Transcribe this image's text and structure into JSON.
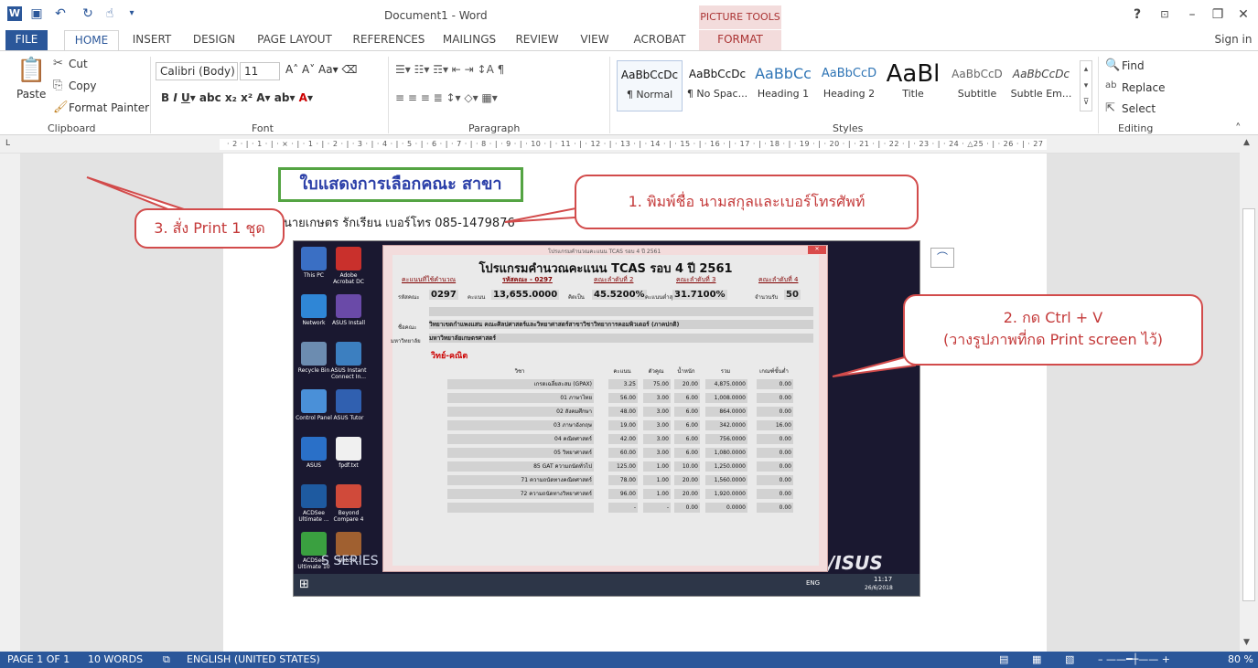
{
  "window": {
    "title": "Document1 - Word",
    "picture_tools": "PICTURE TOOLS",
    "help": "?",
    "signin": "Sign in"
  },
  "tabs": [
    "FILE",
    "HOME",
    "INSERT",
    "DESIGN",
    "PAGE LAYOUT",
    "REFERENCES",
    "MAILINGS",
    "REVIEW",
    "VIEW",
    "ACROBAT",
    "FORMAT"
  ],
  "clipboard": {
    "paste": "Paste",
    "cut": "Cut",
    "copy": "Copy",
    "format_painter": "Format Painter",
    "label": "Clipboard"
  },
  "font": {
    "name": "Calibri (Body)",
    "size": "11",
    "label": "Font"
  },
  "paragraph": {
    "label": "Paragraph"
  },
  "styles": {
    "label": "Styles",
    "items": [
      {
        "sample": "AaBbCcDc",
        "name": "¶ Normal"
      },
      {
        "sample": "AaBbCcDc",
        "name": "¶ No Spac..."
      },
      {
        "sample": "AaBbCc",
        "name": "Heading 1"
      },
      {
        "sample": "AaBbCcD",
        "name": "Heading 2"
      },
      {
        "sample": "AaBl",
        "name": "Title"
      },
      {
        "sample": "AaBbCcD",
        "name": "Subtitle"
      },
      {
        "sample": "AaBbCcDc",
        "name": "Subtle Em..."
      }
    ]
  },
  "editing": {
    "find": "Find",
    "replace": "Replace",
    "select": "Select",
    "label": "Editing"
  },
  "ruler": {
    "numbers": "· 2 · | · 1 · | · ⨯ · | · 1 · | · 2 · | · 3 · | · 4 · | · 5 · | · 6 · | · 7 · | · 8 · | · 9 · | · 10 · | · 11 · | · 12 · | · 13 · | · 14 · | · 15 · | · 16 · | · 17 · | · 18 · | · 19 · | · 20 · | · 21 · | · 22 · | · 23 · | · 24 · △25 · | · 26 · | · 27"
  },
  "document": {
    "title_box": "ใบแสดงการเลือกคณะ สาขา",
    "name_line": "นายเกษตร รักเรียน เบอร์โทร 085-1479876",
    "callout1": "1. พิมพ์ชื่อ นามสกุลและเบอร์โทรศัพท์",
    "callout2_line1": "2. กด Ctrl + V",
    "callout2_line2": "(วางรูปภาพที่กด Print screen ไว้)",
    "callout3": "3. สั่ง Print 1 ชุด"
  },
  "program": {
    "window_title": "โปรแกรมคำนวณคะแนน TCAS รอบ 4 ปี 2561",
    "title": "โปรแกรมคำนวณคะแนน TCAS รอบ 4 ปี 2561",
    "tabs": [
      "คะแนนที่ใช้คำนวณ",
      "รหัสคณะ - 0297",
      "คณะลำดับที่ 2",
      "คณะลำดับที่ 3",
      "คณะลำดับที่ 4"
    ],
    "code_label": "รหัสคณะ",
    "code": "0297",
    "score_label": "คะแนน",
    "score": "13,655.0000",
    "percent_label": "คิดเป็น",
    "percent": "45.5200%",
    "min_label": "คะแนนต่ำสุด",
    "min": "31.7100%",
    "seats_label": "จำนวนรับ",
    "seats": "50",
    "faculty_label": "ชื่อคณะ",
    "faculty": "วิทยาเขตกำแพงแสน คณะศิลปศาสตร์และวิทยาศาสตร์สาขาวิชาวิทยาการคอมพิวเตอร์ (ภาคปกติ)",
    "uni_label": "มหาวิทยาลัย",
    "uni": "มหาวิทยาลัยเกษตรศาสตร์",
    "track": "วิทย์-คณิต",
    "headers": [
      "วิชา",
      "คะแนน",
      "ตัวคูณ",
      "น้ำหนัก",
      "รวม",
      "เกณฑ์ขั้นต่ำ"
    ],
    "rows": [
      [
        "เกรดเฉลี่ยสะสม (GPAX)",
        "3.25",
        "75.00",
        "20.00",
        "4,875.0000",
        "0.00"
      ],
      [
        "01 ภาษาไทย",
        "56.00",
        "3.00",
        "6.00",
        "1,008.0000",
        "0.00"
      ],
      [
        "02 สังคมศึกษา",
        "48.00",
        "3.00",
        "6.00",
        "864.0000",
        "0.00"
      ],
      [
        "03 ภาษาอังกฤษ",
        "19.00",
        "3.00",
        "6.00",
        "342.0000",
        "16.00"
      ],
      [
        "04 คณิตศาสตร์",
        "42.00",
        "3.00",
        "6.00",
        "756.0000",
        "0.00"
      ],
      [
        "05 วิทยาศาสตร์",
        "60.00",
        "3.00",
        "6.00",
        "1,080.0000",
        "0.00"
      ],
      [
        "85 GAT ความถนัดทั่วไป",
        "125.00",
        "1.00",
        "10.00",
        "1,250.0000",
        "0.00"
      ],
      [
        "71 ความถนัดทางคณิตศาสตร์",
        "78.00",
        "1.00",
        "20.00",
        "1,560.0000",
        "0.00"
      ],
      [
        "72 ความถนัดทางวิทยาศาสตร์",
        "96.00",
        "1.00",
        "20.00",
        "1,920.0000",
        "0.00"
      ],
      [
        "",
        "-",
        "-",
        "0.00",
        "0.0000",
        "0.00"
      ]
    ]
  },
  "desktop": {
    "icons": [
      "This PC",
      "Adobe Acrobat DC",
      "Network",
      "ASUS Install",
      "Recycle Bin",
      "ASUS Instant Connect In...",
      "Control Panel",
      "ASUS Tutor",
      "ASUS",
      "fpdf.txt",
      "ACDSee Ultimate ...",
      "Beyond Compare 4",
      "ACDSee Ultimate 10",
      "WebSt..."
    ],
    "brand": "/ISUS",
    "series": "S SERIES",
    "clock_time": "11:17",
    "clock_date": "26/6/2018",
    "lang": "ENG"
  },
  "status": {
    "page": "PAGE 1 OF 1",
    "words": "10 WORDS",
    "language": "ENGLISH (UNITED STATES)",
    "zoom": "80 %"
  },
  "colors": {
    "accent": "#2b579a",
    "callout": "#d24b4b",
    "title_border": "#54a443",
    "title_text": "#2b3fa8"
  }
}
